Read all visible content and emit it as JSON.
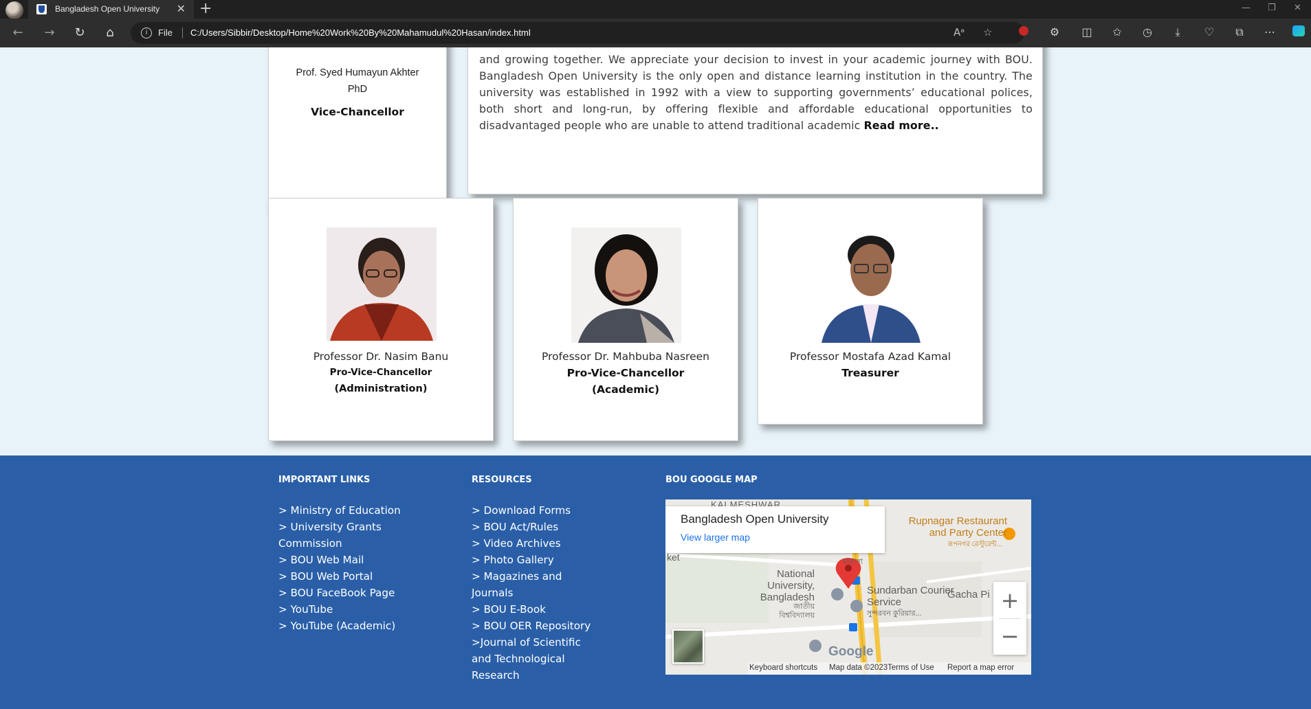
{
  "browser": {
    "tab_title": "Bangladesh Open University",
    "tab_close": "✕",
    "new_tab": "+",
    "file_label": "File",
    "url": "C:/Users/Sibbir/Desktop/Home%20Work%20By%20Mahamudul%20Hasan/index.html",
    "read_aloud": "Aᵃ"
  },
  "vc_card": {
    "name_line1": "Prof. Syed Humayun Akhter",
    "name_line2": "PhD",
    "role": "Vice-Chancellor"
  },
  "message": {
    "text": "and growing together. We appreciate your decision to invest in your academic journey with BOU. Bangladesh Open University is the only open and distance learning institution in the country. The university was established in 1992 with a view to supporting governments’ educational polices, both short and long-run, by offering flexible and affordable educational opportunities to disadvantaged people who are unable to attend traditional academic ",
    "read_more": "Read more.."
  },
  "officials": [
    {
      "name": "Professor Dr. Nasim Banu",
      "role_line1": "Pro-Vice-Chancellor",
      "role_line2": "(Administration)"
    },
    {
      "name": "Professor Dr. Mahbuba Nasreen",
      "role_line1": "Pro-Vice-Chancellor",
      "role_line2": "(Academic)"
    },
    {
      "name": "Professor Mostafa Azad Kamal",
      "role_line1": "Treasurer",
      "role_line2": ""
    }
  ],
  "footer": {
    "important_links": {
      "heading": "IMPORTANT LINKS",
      "items": [
        "> Ministry of Education",
        "> University Grants Commission",
        "> BOU Web Mail",
        "> BOU Web Portal",
        "> BOU FaceBook Page",
        "> YouTube",
        "> YouTube (Academic)"
      ]
    },
    "resources": {
      "heading": "RESOURCES",
      "items": [
        "> Download Forms",
        "> BOU Act/Rules",
        "> Video Archives",
        "> Photo Gallery",
        "> Magazines and Journals",
        "> BOU E-Book",
        "> BOU OER Repository",
        ">Journal of Scientific and Technological Research"
      ]
    },
    "map": {
      "heading": "BOU GOOGLE MAP",
      "place_title": "Bangladesh Open University",
      "view_larger": "View larger map",
      "labels": {
        "kalmeshwar": "KALMESHWAR",
        "ket": "ket",
        "national_university": "National University, Bangladesh",
        "national_university_bn": "জাতীয় বিশ্ববিদ্যালয়",
        "sundarban": "Sundarban Courier Service",
        "sundarban_bn": "সুন্দরবন কুরিয়ার...",
        "gacha": "Gacha Pi",
        "rupnagar": "Rupnagar Restaurant and Party Center",
        "rupnagar_bn": "রূপনগর রেস্টুরেন্ট...",
        "masjid_bn": "মারাসা"
      },
      "google": "Google",
      "keyboard_shortcuts": "Keyboard shortcuts",
      "map_data": "Map data ©2023",
      "terms": "Terms of Use",
      "report": "Report a map error",
      "zoom_in": "+",
      "zoom_out": "−"
    }
  },
  "colors": {
    "page_bg": "#e8f3f9",
    "footer_bg": "#2a5fa8",
    "chrome_bg": "#2e2e2e",
    "map_pin": "#e53935"
  }
}
